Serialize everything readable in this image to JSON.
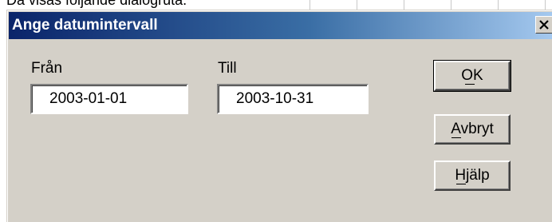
{
  "background_text": "Då visas följande dialogruta.",
  "dialog": {
    "title": "Ange datumintervall",
    "close_glyph": "✕",
    "fields": {
      "from": {
        "label": "Från",
        "value": "2003-01-01"
      },
      "to": {
        "label": "Till",
        "value": "2003-10-31"
      }
    },
    "buttons": {
      "ok": "OK",
      "cancel": "Avbryt",
      "help": "Hjälp"
    }
  },
  "colors": {
    "face": "#d4d0c8",
    "title_start": "#0a246a",
    "title_end": "#a6caf0"
  }
}
